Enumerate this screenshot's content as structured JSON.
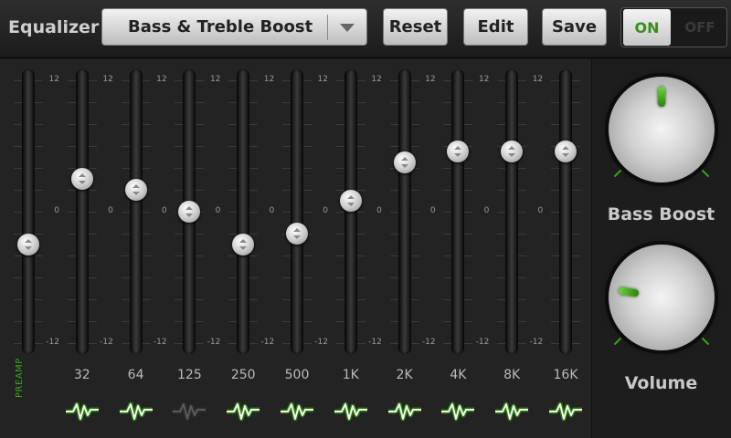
{
  "header": {
    "title": "Equalizer",
    "preset": "Bass & Treble Boost",
    "reset_label": "Reset",
    "edit_label": "Edit",
    "save_label": "Save",
    "toggle_on": "ON",
    "toggle_off": "OFF"
  },
  "equalizer": {
    "preamp_label": "PREAMP",
    "scale_labels": {
      "top": "12",
      "mid": "0",
      "bottom": "-12"
    },
    "bands": [
      {
        "label": "",
        "level": -3
      },
      {
        "label": "32",
        "level": 3
      },
      {
        "label": "64",
        "level": 2
      },
      {
        "label": "125",
        "level": 0
      },
      {
        "label": "250",
        "level": -3
      },
      {
        "label": "500",
        "level": -2
      },
      {
        "label": "1K",
        "level": 1
      },
      {
        "label": "2K",
        "level": 4.5
      },
      {
        "label": "4K",
        "level": 5.5
      },
      {
        "label": "8K",
        "level": 5.5
      },
      {
        "label": "16K",
        "level": 5.5
      }
    ],
    "wave_states": [
      true,
      true,
      false,
      true,
      true,
      true,
      true,
      true,
      true,
      true
    ]
  },
  "dials": {
    "bass_boost": {
      "label": "Bass Boost",
      "level": 0.5
    },
    "volume": {
      "label": "Volume",
      "level": 0.2
    }
  },
  "colors": {
    "accent": "#3da318",
    "panel": "#232323"
  }
}
